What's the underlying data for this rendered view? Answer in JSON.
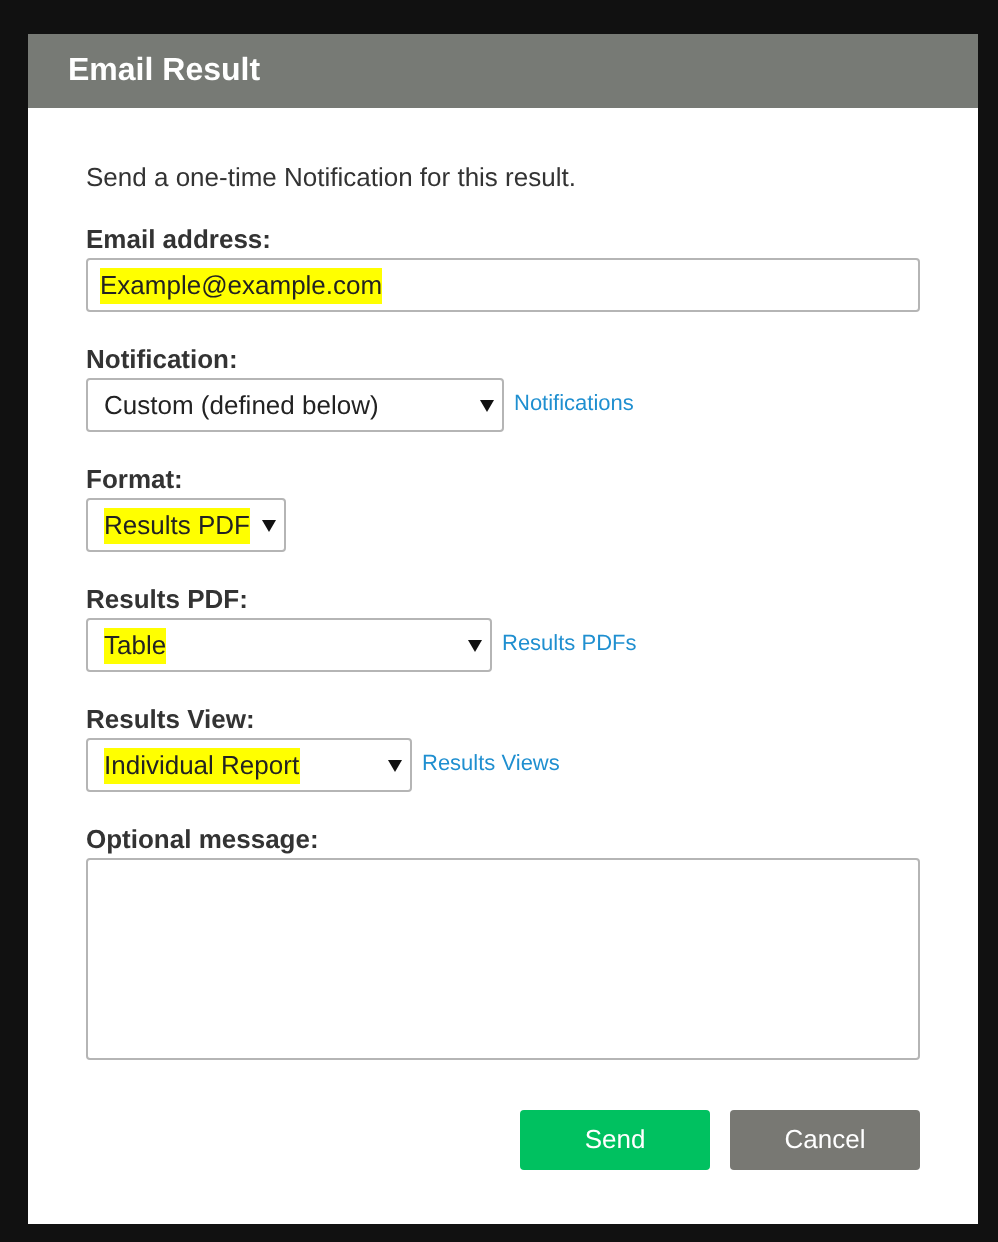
{
  "dialog": {
    "title": "Email Result",
    "description": "Send a one-time Notification for this result."
  },
  "fields": [
    {
      "kind": "text",
      "label": "Email address:",
      "value": "Example@example.com",
      "highlighted": true
    },
    {
      "kind": "select",
      "label": "Notification:",
      "value": "Custom (defined below)",
      "highlighted": false,
      "link": "Notifications"
    },
    {
      "kind": "select",
      "label": "Format:",
      "value": "Results PDF",
      "highlighted": true
    },
    {
      "kind": "select",
      "label": "Results PDF:",
      "value": "Table",
      "highlighted": true,
      "link": "Results PDFs"
    },
    {
      "kind": "select",
      "label": "Results View:",
      "value": "Individual Report",
      "highlighted": true,
      "link": "Results Views"
    },
    {
      "kind": "textarea",
      "label": "Optional message:"
    }
  ],
  "buttons": [
    {
      "label": "Send",
      "kind": "primary"
    },
    {
      "label": "Cancel",
      "kind": "secondary"
    }
  ]
}
